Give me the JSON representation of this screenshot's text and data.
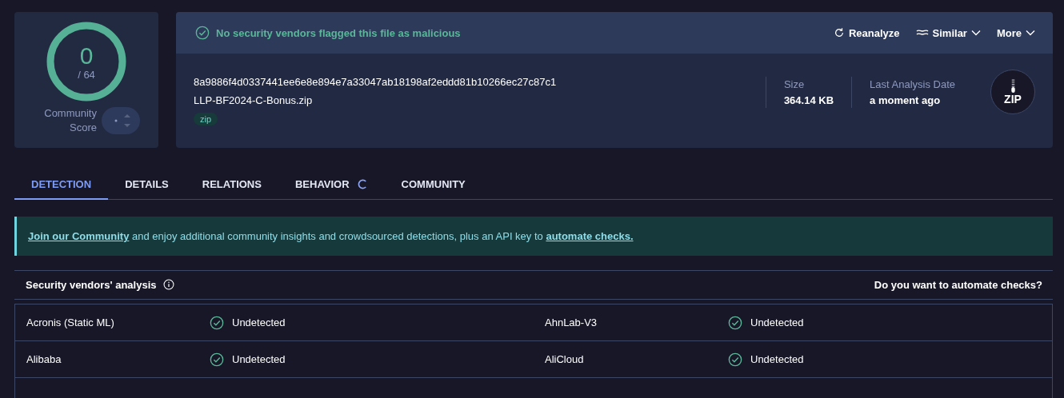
{
  "score": {
    "value": "0",
    "total": "/ 64",
    "label": "Community Score"
  },
  "verdict": {
    "text": "No security vendors flagged this file as malicious",
    "malicious": false
  },
  "actions": [
    {
      "label": "Reanalyze",
      "kind": "reanalyze"
    },
    {
      "label": "Similar",
      "kind": "similar"
    },
    {
      "label": "More",
      "kind": "more"
    }
  ],
  "file": {
    "hash": "8a9886f4d0337441ee6e8e894e7a33047ab18198af2eddd81b10266ec27c87c1",
    "name": "LLP-BF2024-C-Bonus.zip",
    "tags": [
      "zip"
    ]
  },
  "stats": [
    {
      "label": "Size",
      "value": "364.14 KB"
    },
    {
      "label": "Last Analysis Date",
      "value": "a moment ago"
    }
  ],
  "file_type": "ZIP",
  "tabs": [
    {
      "label": "DETECTION",
      "selected": true,
      "loading": false
    },
    {
      "label": "DETAILS",
      "selected": false,
      "loading": false
    },
    {
      "label": "RELATIONS",
      "selected": false,
      "loading": false
    },
    {
      "label": "BEHAVIOR",
      "selected": false,
      "loading": true
    },
    {
      "label": "COMMUNITY",
      "selected": false,
      "loading": false
    }
  ],
  "banner": {
    "link": "Join our Community",
    "text": " and enjoy additional community insights and crowdsourced detections, plus an API key to ",
    "link_2": "automate checks."
  },
  "analysis": {
    "title": "Security vendors' analysis",
    "cta": "Do you want to automate checks?"
  },
  "vendors": [
    {
      "name": "Acronis (Static ML)",
      "result": "Undetected",
      "detected": false
    },
    {
      "name": "AhnLab-V3",
      "result": "Undetected",
      "detected": false
    },
    {
      "name": "Alibaba",
      "result": "Undetected",
      "detected": false
    },
    {
      "name": "AliCloud",
      "result": "Undetected",
      "detected": false
    }
  ]
}
